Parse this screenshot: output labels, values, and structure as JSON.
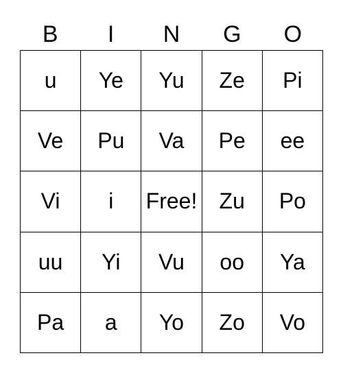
{
  "header": [
    "B",
    "I",
    "N",
    "G",
    "O"
  ],
  "cells": [
    [
      "u",
      "Ye",
      "Yu",
      "Ze",
      "Pi"
    ],
    [
      "Ve",
      "Pu",
      "Va",
      "Pe",
      "ee"
    ],
    [
      "Vi",
      "i",
      "Free!",
      "Zu",
      "Po"
    ],
    [
      "uu",
      "Yi",
      "Vu",
      "oo",
      "Ya"
    ],
    [
      "Pa",
      "a",
      "Yo",
      "Zo",
      "Vo"
    ]
  ]
}
